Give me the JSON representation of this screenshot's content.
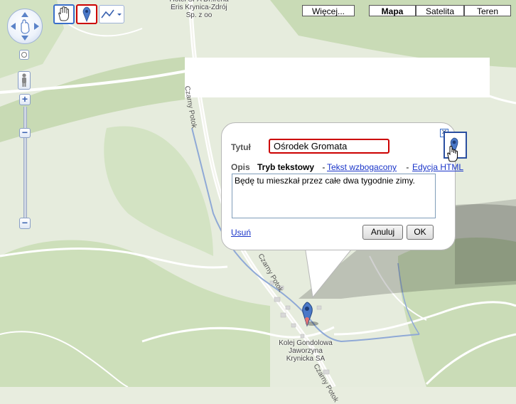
{
  "map_types": {
    "more": "Więcej...",
    "map": "Mapa",
    "satellite": "Satelita",
    "terrain": "Teren",
    "active": "Mapa"
  },
  "map_labels": {
    "hotel": "Hotel SPA Dr.Irena\nEris Krynica-Zdrój\nSp. z oo",
    "station": "Kolej Gondolowa\nJaworzyna\nKrynicka SA",
    "road": "Czarny Potok"
  },
  "toolbar": {
    "hand_icon": "hand-icon",
    "marker_icon": "placemark-icon",
    "line_icon": "line-icon"
  },
  "zoom": {
    "plus": "+",
    "minus": "−"
  },
  "balloon": {
    "title_label": "Tytuł",
    "title_value": "Ośrodek Gromata",
    "desc_label": "Opis",
    "mode_plain": "Tryb tekstowy",
    "sep1": " - ",
    "mode_rich": "Tekst wzbogacony",
    "sep2": " - ",
    "mode_html": "Edycja HTML",
    "description": "Będę tu mieszkał przez całe dwa tygodnie zimy.",
    "delete": "Usuń",
    "cancel": "Anuluj",
    "ok": "OK"
  },
  "colors": {
    "map_bg": "#e8eddf",
    "forest": "#c9dcb7",
    "road": "#ffffff",
    "river": "#8fa9d6",
    "highlight_red": "#cc0000",
    "link": "#1a35c9"
  }
}
